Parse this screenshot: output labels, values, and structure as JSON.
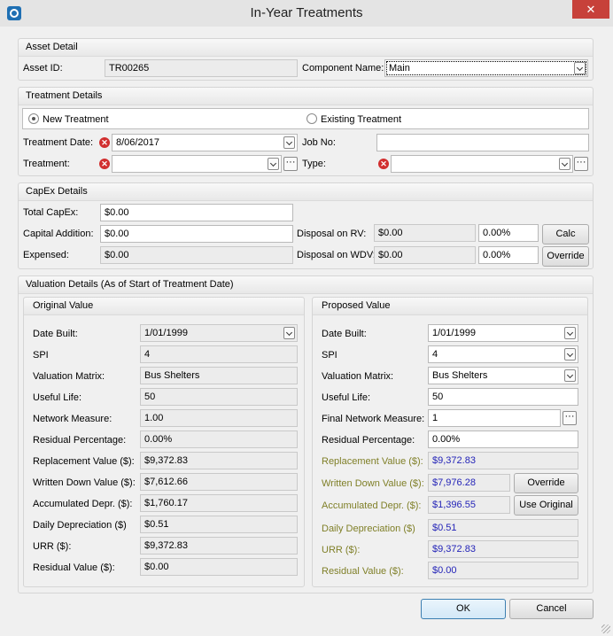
{
  "window": {
    "title": "In-Year Treatments",
    "close_glyph": "✕"
  },
  "asset_detail": {
    "header": "Asset Detail",
    "asset_id_label": "Asset ID:",
    "asset_id_value": "TR00265",
    "component_label": "Component Name:",
    "component_value": "Main"
  },
  "treatment_details": {
    "header": "Treatment Details",
    "radio_new": "New Treatment",
    "radio_existing": "Existing Treatment",
    "selected": "New Treatment",
    "date_label": "Treatment Date:",
    "date_value": "8/06/2017",
    "job_label": "Job No:",
    "job_value": "",
    "treatment_label": "Treatment:",
    "treatment_value": "",
    "type_label": "Type:",
    "type_value": "",
    "ellipsis": "···",
    "error_glyph": "✕"
  },
  "capex": {
    "header": "CapEx Details",
    "total_label": "Total CapEx:",
    "total_value": "$0.00",
    "addition_label": "Capital Addition:",
    "addition_value": "$0.00",
    "expensed_label": "Expensed:",
    "expensed_value": "$0.00",
    "disposal_rv_label": "Disposal on RV:",
    "disposal_rv_value": "$0.00",
    "disposal_rv_pct": "0.00%",
    "disposal_wdv_label": "Disposal on WDV:",
    "disposal_wdv_value": "$0.00",
    "disposal_wdv_pct": "0.00%",
    "calc_button": "Calc",
    "override_button": "Override"
  },
  "valuation": {
    "header": "Valuation Details (As of Start of Treatment Date)",
    "original": {
      "header": "Original Value",
      "date_built_label": "Date Built:",
      "date_built": "1/01/1999",
      "spi_label": "SPI",
      "spi": "4",
      "matrix_label": "Valuation Matrix:",
      "matrix": "Bus Shelters",
      "useful_life_label": "Useful Life:",
      "useful_life": "50",
      "network_label": "Network Measure:",
      "network": "1.00",
      "residual_pct_label": "Residual Percentage:",
      "residual_pct": "0.00%",
      "replacement_label": "Replacement Value ($):",
      "replacement": "$9,372.83",
      "wdv_label": "Written Down Value ($):",
      "wdv": "$7,612.66",
      "acc_depr_label": "Accumulated Depr. ($):",
      "acc_depr": "$1,760.17",
      "daily_label": "Daily Depreciation ($)",
      "daily": "$0.51",
      "urr_label": "URR ($):",
      "urr": "$9,372.83",
      "residual_value_label": "Residual Value ($):",
      "residual_value": "$0.00"
    },
    "proposed": {
      "header": "Proposed Value",
      "date_built_label": "Date Built:",
      "date_built": "1/01/1999",
      "spi_label": "SPI",
      "spi": "4",
      "matrix_label": "Valuation Matrix:",
      "matrix": "Bus Shelters",
      "useful_life_label": "Useful Life:",
      "useful_life": "50",
      "network_label": "Final Network Measure:",
      "network": "1",
      "residual_pct_label": "Residual Percentage:",
      "residual_pct": "0.00%",
      "replacement_label": "Replacement Value ($):",
      "replacement": "$9,372.83",
      "wdv_label": "Written Down Value ($):",
      "wdv": "$7,976.28",
      "acc_depr_label": "Accumulated Depr. ($):",
      "acc_depr": "$1,396.55",
      "daily_label": "Daily Depreciation  ($)",
      "daily": "$0.51",
      "urr_label": "URR ($):",
      "urr": "$9,372.83",
      "residual_value_label": "Residual Value ($):",
      "residual_value": "$0.00",
      "override_button": "Override",
      "use_original_button": "Use Original"
    }
  },
  "footer": {
    "ok": "OK",
    "cancel": "Cancel"
  },
  "colors": {
    "olive_label": "#7f7f27",
    "blue_value": "#2424b8",
    "error": "#d12e2e",
    "close": "#c7413a"
  }
}
